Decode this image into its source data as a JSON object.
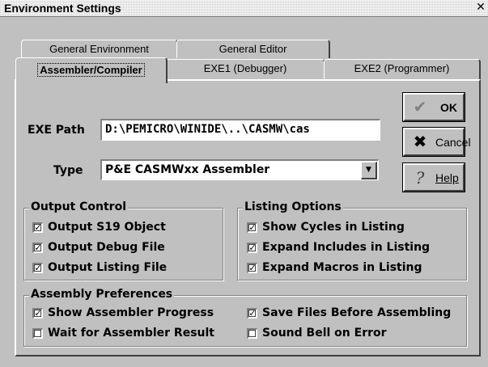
{
  "window": {
    "title": "Environment Settings",
    "close_glyph": "✕"
  },
  "tabs_back": [
    "General Environment",
    "General Editor"
  ],
  "tabs_front": [
    "Assembler/Compiler",
    "EXE1 (Debugger)",
    "EXE2 (Programmer)"
  ],
  "exe_path": {
    "label": "EXE Path",
    "value": "D:\\PEMICRO\\WINIDE\\..\\CASMW\\cas"
  },
  "type": {
    "label": "Type",
    "value": "P&E CASMWxx Assembler",
    "arrow": "▼"
  },
  "buttons": {
    "ok": {
      "label": "OK",
      "icon": "checkmark-icon",
      "glyph": "✔",
      "color": "#808080"
    },
    "cancel": {
      "label": "Cancel",
      "icon": "x-icon",
      "glyph": "✖",
      "color": "#000000"
    },
    "help": {
      "label": "Help",
      "icon": "question-icon",
      "glyph": "?"
    }
  },
  "output_control": {
    "title": "Output Control",
    "items": [
      {
        "label": "Output S19 Object",
        "checked": true
      },
      {
        "label": "Output Debug File",
        "checked": true
      },
      {
        "label": "Output Listing File",
        "checked": true
      }
    ]
  },
  "listing_options": {
    "title": "Listing Options",
    "items": [
      {
        "label": "Show Cycles in Listing",
        "checked": true
      },
      {
        "label": "Expand Includes in Listing",
        "checked": true
      },
      {
        "label": "Expand Macros in Listing",
        "checked": true
      }
    ]
  },
  "assembly_preferences": {
    "title": "Assembly Preferences",
    "items": [
      {
        "label": "Show Assembler Progress",
        "checked": true
      },
      {
        "label": "Wait for Assembler Result",
        "checked": false
      },
      {
        "label": "Save Files Before Assembling",
        "checked": true
      },
      {
        "label": "Sound Bell on Error",
        "checked": false
      }
    ]
  },
  "check_glyph": "✓"
}
